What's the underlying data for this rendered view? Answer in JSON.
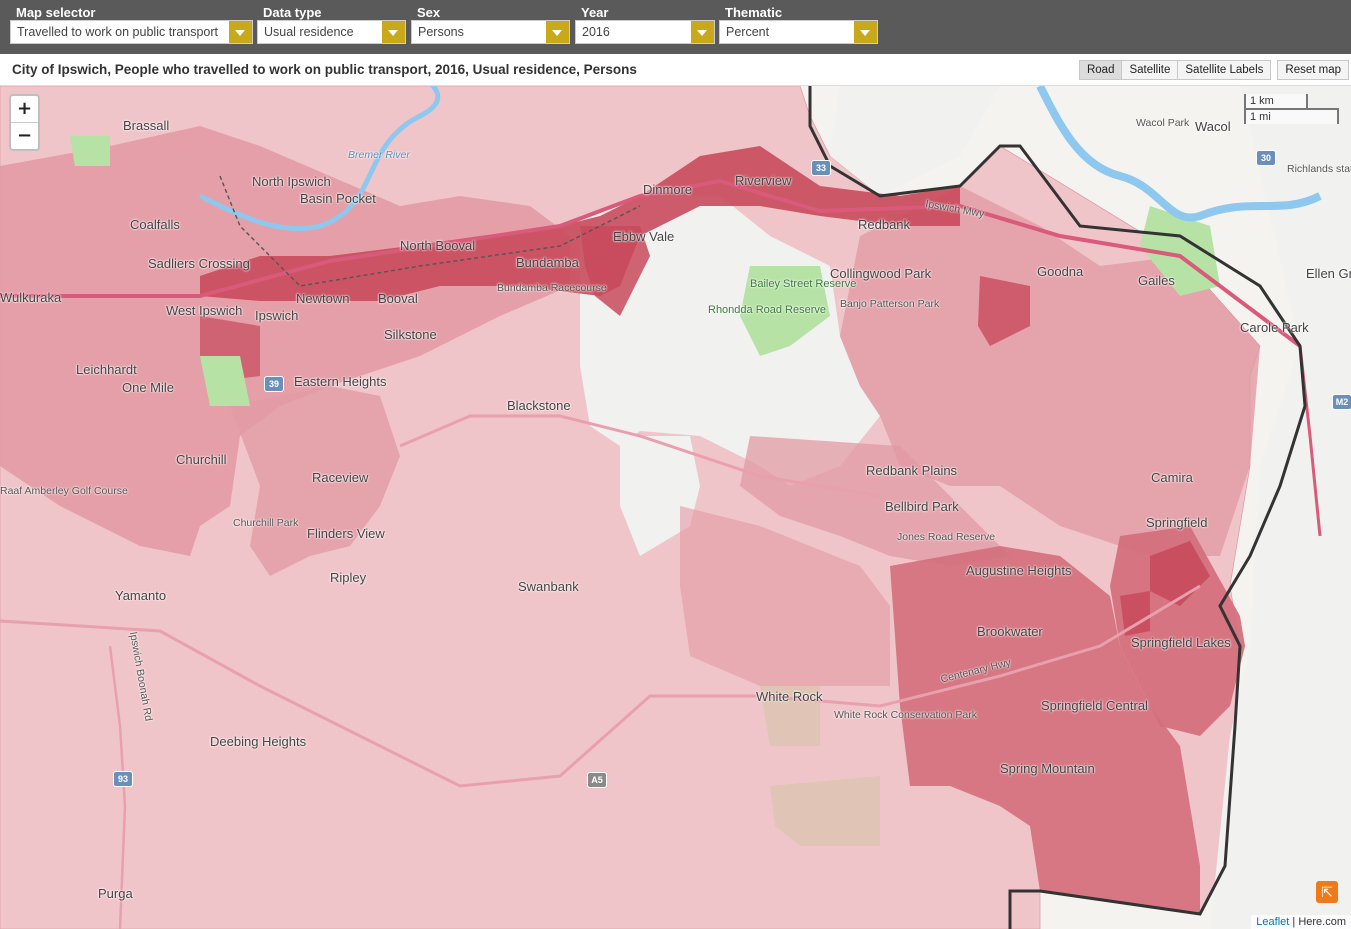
{
  "controls": [
    {
      "label": "Map selector",
      "value": "Travelled to work on public transport"
    },
    {
      "label": "Data type",
      "value": "Usual residence"
    },
    {
      "label": "Sex",
      "value": "Persons"
    },
    {
      "label": "Year",
      "value": "2016"
    },
    {
      "label": "Thematic",
      "value": "Percent"
    }
  ],
  "map": {
    "title": "City of Ipswich, People who travelled to work on public transport, 2016, Usual residence, Persons",
    "buttons": {
      "road": "Road",
      "satellite": "Satellite",
      "satellite_labels": "Satellite Labels",
      "reset": "Reset map"
    },
    "zoom_in": "+",
    "zoom_out": "−",
    "scale_km": "1 km",
    "scale_mi": "1 mi",
    "attribution_link": "Leaflet",
    "attribution_sep": " | ",
    "attribution_text": "Here.com",
    "colors": {
      "light": "#eebcc2",
      "mid": "#e29aa4",
      "dark": "#d4707d",
      "darkest": "#c84a5c",
      "boundary": "#333333",
      "river": "#8ec8ee",
      "motorway": "#d95a7a"
    }
  },
  "places": [
    {
      "name": "Brassall"
    },
    {
      "name": "North Ipswich"
    },
    {
      "name": "Basin Pocket"
    },
    {
      "name": "Coalfalls"
    },
    {
      "name": "Sadliers Crossing"
    },
    {
      "name": "Wulkuraka"
    },
    {
      "name": "West Ipswich"
    },
    {
      "name": "Ipswich"
    },
    {
      "name": "Newtown"
    },
    {
      "name": "Booval"
    },
    {
      "name": "North Booval"
    },
    {
      "name": "Bundamba"
    },
    {
      "name": "Silkstone"
    },
    {
      "name": "Ebbw Vale"
    },
    {
      "name": "Dinmore"
    },
    {
      "name": "Riverview"
    },
    {
      "name": "Redbank"
    },
    {
      "name": "Goodna"
    },
    {
      "name": "Gailes"
    },
    {
      "name": "Wacol"
    },
    {
      "name": "Ellen Grove"
    },
    {
      "name": "Carole Park"
    },
    {
      "name": "Collingwood Park"
    },
    {
      "name": "Leichhardt"
    },
    {
      "name": "One Mile"
    },
    {
      "name": "Eastern Heights"
    },
    {
      "name": "Blackstone"
    },
    {
      "name": "Churchill"
    },
    {
      "name": "Raceview"
    },
    {
      "name": "Flinders View"
    },
    {
      "name": "Ripley"
    },
    {
      "name": "Yamanto"
    },
    {
      "name": "Swanbank"
    },
    {
      "name": "Redbank Plains"
    },
    {
      "name": "Bellbird Park"
    },
    {
      "name": "Camira"
    },
    {
      "name": "Springfield"
    },
    {
      "name": "Augustine Heights"
    },
    {
      "name": "Brookwater"
    },
    {
      "name": "Springfield Lakes"
    },
    {
      "name": "Springfield Central"
    },
    {
      "name": "White Rock"
    },
    {
      "name": "Spring Mountain"
    },
    {
      "name": "Deebing Heights"
    },
    {
      "name": "Purga"
    }
  ],
  "minor_labels": [
    {
      "name": "Bremer River"
    },
    {
      "name": "Bailey Street Reserve"
    },
    {
      "name": "Rhondda Road Reserve"
    },
    {
      "name": "Banjo Patterson Park"
    },
    {
      "name": "Jones Road Reserve"
    },
    {
      "name": "White Rock Conservation Park"
    },
    {
      "name": "Wacol Park"
    },
    {
      "name": "Raaf Amberley Golf Course"
    },
    {
      "name": "Churchill Park"
    },
    {
      "name": "Bundamba Racecourse"
    },
    {
      "name": "Richlands station"
    },
    {
      "name": "Ipswich Mwy"
    },
    {
      "name": "Centenary Hwy"
    },
    {
      "name": "Ipswich Boonah Rd"
    }
  ],
  "shields": [
    "33",
    "30",
    "93",
    "39",
    "M2",
    "A5"
  ]
}
